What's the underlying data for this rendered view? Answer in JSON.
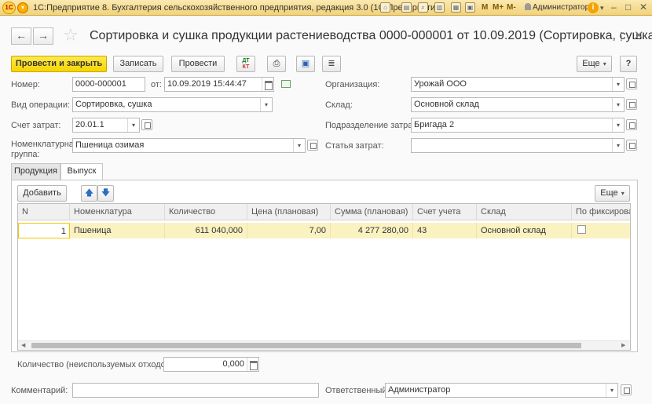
{
  "window": {
    "title": "1С:Предприятие 8. Бухгалтерия сельскохозяйственного предприятия, редакция 3.0  (1С:Предприятие)",
    "logo_text": "1С",
    "mem_buttons": [
      "M",
      "M+",
      "M-"
    ],
    "user": "Администратор"
  },
  "document": {
    "title": "Сортировка и сушка продукции растениеводства 0000-000001 от 10.09.2019 (Сортировка, сушка)"
  },
  "toolbar": {
    "post_close": "Провести и закрыть",
    "save": "Записать",
    "post": "Провести",
    "dtkt_top": "ДТ",
    "dtkt_bottom": "КТ",
    "more": "Еще",
    "help": "?"
  },
  "form": {
    "number_label": "Номер:",
    "number_value": "0000-000001",
    "date_label": "от:",
    "date_value": "10.09.2019 15:44:47",
    "operation_label": "Вид операции:",
    "operation_value": "Сортировка, сушка",
    "cost_account_label": "Счет затрат:",
    "cost_account_value": "20.01.1",
    "item_group_label_1": "Номенклатурная",
    "item_group_label_2": "группа:",
    "item_group_value": "Пшеница озимая",
    "organization_label": "Организация:",
    "organization_value": "Урожай ООО",
    "warehouse_label": "Склад:",
    "warehouse_value": "Основной склад",
    "cost_division_label": "Подразделение затрат:",
    "cost_division_value": "Бригада 2",
    "cost_item_label": "Статья затрат:",
    "cost_item_value": ""
  },
  "tabs": [
    {
      "label": "Продукция"
    },
    {
      "label": "Выпуск"
    }
  ],
  "table": {
    "add_button": "Добавить",
    "more": "Еще",
    "columns": [
      "N",
      "Номенклатура",
      "Количество",
      "Цена (плановая)",
      "Сумма (плановая)",
      "Счет учета",
      "Склад",
      "По фиксирован"
    ],
    "rows": [
      {
        "n": "1",
        "item": "Пшеница",
        "qty": "611 040,000",
        "price": "7,00",
        "sum": "4 277 280,00",
        "account": "43",
        "warehouse": "Основной склад",
        "fixed": false
      }
    ]
  },
  "waste": {
    "label": "Количество (неиспользуемых отходов):",
    "value": "0,000"
  },
  "footer": {
    "comment_label": "Комментарий:",
    "comment_value": "",
    "responsible_label": "Ответственный:",
    "responsible_value": "Администратор"
  },
  "colors": {
    "primary_button": "#f6d500",
    "selected_row": "#fbf2c1",
    "titlebar": "#f2d27a"
  }
}
